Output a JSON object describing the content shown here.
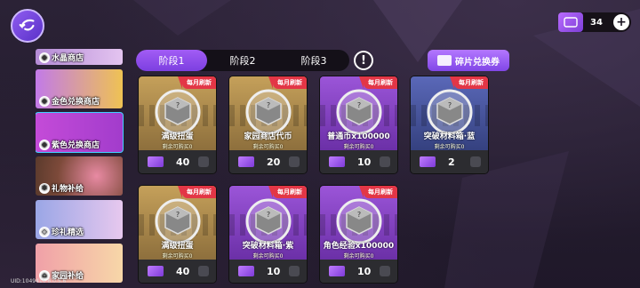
{
  "currency": {
    "value": "34",
    "plus": "+"
  },
  "sidebar": {
    "items": [
      {
        "label": "水晶商店"
      },
      {
        "label": "金色兑换商店"
      },
      {
        "label": "紫色兑换商店"
      },
      {
        "label": "礼物补给"
      },
      {
        "label": "珍礼精选"
      },
      {
        "label": "家园补给"
      }
    ]
  },
  "uid": "UID:1049416 6.0.5.6",
  "tabs": [
    {
      "label": "阶段1"
    },
    {
      "label": "阶段2"
    },
    {
      "label": "阶段3"
    }
  ],
  "alert": {
    "label": "!"
  },
  "exchange": {
    "label": "碎片兑换券"
  },
  "cards": [
    {
      "badge": "每月刷新",
      "name": "满级扭蛋",
      "remain": "剩余可购买0",
      "cost": "40",
      "theme": "gold"
    },
    {
      "badge": "每月刷新",
      "name": "家园商店代币",
      "remain": "剩余可购买0",
      "cost": "20",
      "theme": "gold"
    },
    {
      "badge": "每月刷新",
      "name": "普通币x100000",
      "remain": "剩余可购买0",
      "cost": "10",
      "theme": "purple"
    },
    {
      "badge": "每月刷新",
      "name": "突破材料箱·蓝",
      "remain": "剩余可购买0",
      "cost": "2",
      "theme": "blue"
    },
    {
      "badge": "每月刷新",
      "name": "满级扭蛋",
      "remain": "剩余可购买0",
      "cost": "40",
      "theme": "gold"
    },
    {
      "badge": "每月刷新",
      "name": "突破材料箱·紫",
      "remain": "剩余可购买0",
      "cost": "10",
      "theme": "purple"
    },
    {
      "badge": "每月刷新",
      "name": "角色经验x100000",
      "remain": "剩余可购买0",
      "cost": "10",
      "theme": "purple"
    }
  ]
}
